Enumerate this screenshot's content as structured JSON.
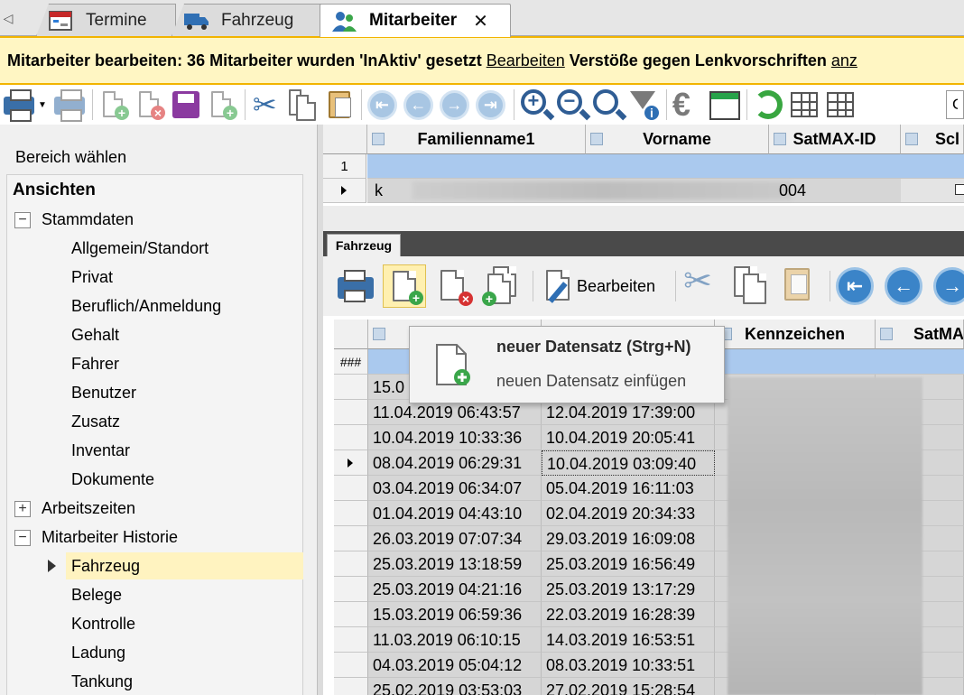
{
  "tabs": [
    {
      "label": "Termine",
      "icon": "calendar-icon"
    },
    {
      "label": "Fahrzeug",
      "icon": "truck-icon"
    },
    {
      "label": "Mitarbeiter",
      "icon": "employees-icon",
      "active": true
    }
  ],
  "infobar": {
    "title": "Mitarbeiter bearbeiten",
    "message": ": 36 Mitarbeiter wurden 'InAktiv' gesetzt",
    "link1": "Bearbeiten",
    "message2": "Verstöße gegen Lenkvorschriften",
    "link2": "anz"
  },
  "toolbar": {
    "search_value": "G"
  },
  "left": {
    "bereich_label": "Bereich wählen",
    "tree_header": "Ansichten",
    "nodes": [
      {
        "label": "Stammdaten",
        "level": 0,
        "expander": "−"
      },
      {
        "label": "Allgemein/Standort",
        "level": 1
      },
      {
        "label": "Privat",
        "level": 1
      },
      {
        "label": "Beruflich/Anmeldung",
        "level": 1
      },
      {
        "label": "Gehalt",
        "level": 1
      },
      {
        "label": "Fahrer",
        "level": 1
      },
      {
        "label": "Benutzer",
        "level": 1
      },
      {
        "label": "Zusatz",
        "level": 1
      },
      {
        "label": "Inventar",
        "level": 1
      },
      {
        "label": "Dokumente",
        "level": 1
      },
      {
        "label": "Arbeitszeiten",
        "level": 0,
        "expander": "+"
      },
      {
        "label": "Mitarbeiter Historie",
        "level": 0,
        "expander": "−"
      },
      {
        "label": "Fahrzeug",
        "level": 1,
        "selected": true
      },
      {
        "label": "Belege",
        "level": 1
      },
      {
        "label": "Kontrolle",
        "level": 1
      },
      {
        "label": "Ladung",
        "level": 1
      },
      {
        "label": "Tankung",
        "level": 1
      }
    ]
  },
  "upper_grid": {
    "columns": [
      "Familienname1",
      "Vorname",
      "SatMAX-ID",
      "Scl"
    ],
    "row1_header": "1",
    "row2_first": "k",
    "row2_satmax": "004"
  },
  "lower": {
    "tab_label": "Fahrzeug",
    "edit_label": "Bearbeiten",
    "columns": [
      "",
      "",
      "Kennzeichen",
      "SatMA"
    ],
    "new_row_header": "###",
    "rows": [
      {
        "von": "15.0",
        "bis": ""
      },
      {
        "von": "11.04.2019 06:43:57",
        "bis": "12.04.2019 17:39:00"
      },
      {
        "von": "10.04.2019 10:33:36",
        "bis": "10.04.2019 20:05:41"
      },
      {
        "von": "08.04.2019 06:29:31",
        "bis": "10.04.2019 03:09:40",
        "current": true
      },
      {
        "von": "03.04.2019 06:34:07",
        "bis": "05.04.2019 16:11:03"
      },
      {
        "von": "01.04.2019 04:43:10",
        "bis": "02.04.2019 20:34:33"
      },
      {
        "von": "26.03.2019 07:07:34",
        "bis": "29.03.2019 16:09:08"
      },
      {
        "von": "25.03.2019 13:18:59",
        "bis": "25.03.2019 16:56:49"
      },
      {
        "von": "25.03.2019 04:21:16",
        "bis": "25.03.2019 13:17:29"
      },
      {
        "von": "15.03.2019 06:59:36",
        "bis": "22.03.2019 16:28:39"
      },
      {
        "von": "11.03.2019 06:10:15",
        "bis": "14.03.2019 16:53:51"
      },
      {
        "von": "04.03.2019 05:04:12",
        "bis": "08.03.2019 10:33:51"
      },
      {
        "von": "25.02.2019 03:53:03",
        "bis": "27.02.2019 15:28:54"
      }
    ]
  },
  "tooltip": {
    "title": "neuer Datensatz (Strg+N)",
    "description": "neuen Datensatz einfügen"
  }
}
